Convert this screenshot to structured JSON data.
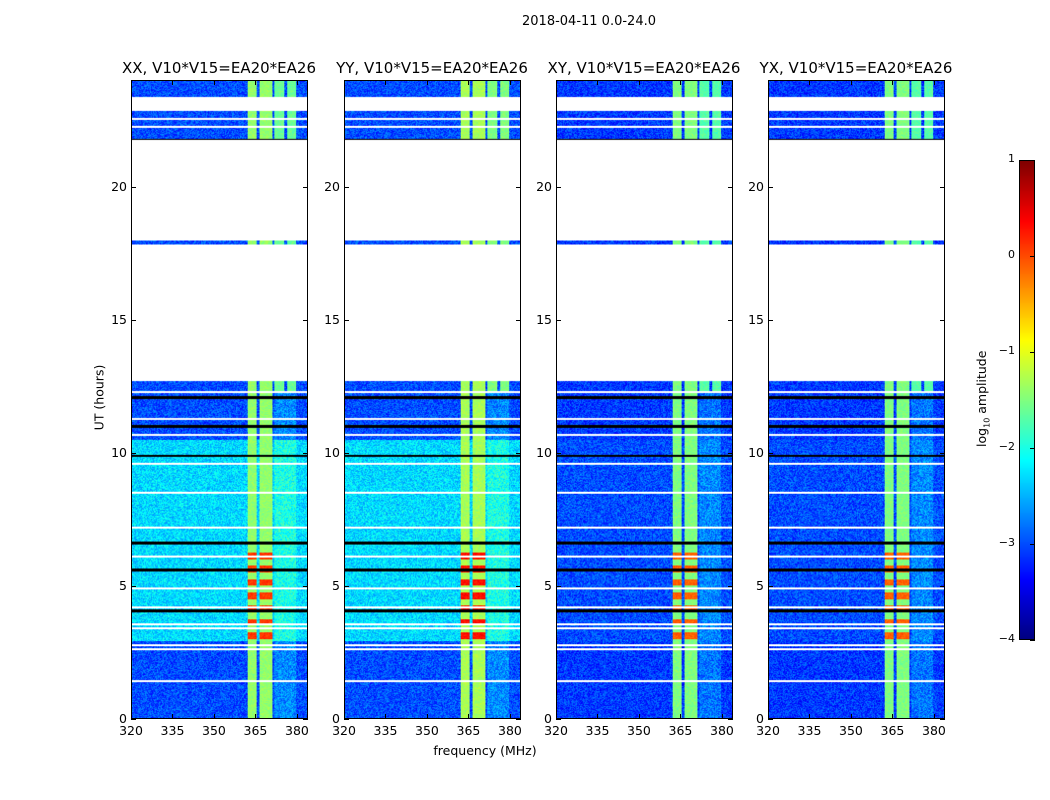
{
  "chart_data": {
    "type": "heatmap",
    "title": "2018-04-11 0.0-24.0",
    "xlabel": "frequency (MHz)",
    "ylabel": "UT (hours)",
    "xlim": [
      320,
      384
    ],
    "ylim": [
      0,
      24
    ],
    "xticks": [
      320,
      335,
      350,
      365,
      380
    ],
    "yticks": [
      0,
      5,
      10,
      15,
      20
    ],
    "colorbar": {
      "label": "log10 amplitude",
      "label_main": "log",
      "label_sub": "10",
      "label_tail": " amplitude",
      "range": [
        -4,
        1
      ],
      "ticks": [
        1,
        0,
        -1,
        -2,
        -3,
        -4
      ],
      "tick_labels": [
        "1",
        "0",
        "−1",
        "−2",
        "−3",
        "−4"
      ],
      "colormap": "jet"
    },
    "panels": [
      {
        "title": "XX, V10*V15=EA20*EA26",
        "base_low": -3.0,
        "base_mid": -2.3,
        "band_level": -1.4,
        "hot_level": 0.1
      },
      {
        "title": "YY, V10*V15=EA20*EA26",
        "base_low": -3.0,
        "base_mid": -2.3,
        "band_level": -1.3,
        "hot_level": 0.3
      },
      {
        "title": "XY, V10*V15=EA20*EA26",
        "base_low": -3.1,
        "base_mid": -3.0,
        "band_level": -1.5,
        "hot_level": -0.1
      },
      {
        "title": "YX, V10*V15=EA20*EA26",
        "base_low": -3.1,
        "base_mid": -3.0,
        "band_level": -1.5,
        "hot_level": -0.1
      }
    ],
    "data_segments_hours": [
      [
        0,
        12.7
      ],
      [
        17.85,
        18.0
      ],
      [
        21.8,
        22.9
      ],
      [
        23.4,
        24
      ]
    ],
    "flagged_lines_hours": [
      1.4,
      2.6,
      2.75,
      3.4,
      3.55,
      4.2,
      4.9,
      6.1,
      7.2,
      8.5,
      9.6,
      10.7,
      11.3,
      12.3,
      22.3,
      22.6
    ],
    "dark_lines_hours": [
      5.6,
      4.05,
      6.6,
      9.9,
      11.0,
      12.1,
      21.8
    ],
    "rfi_band_mhz": [
      362,
      371
    ],
    "hot_time_hours": [
      3.0,
      6.5
    ],
    "upper_band_mhz": [
      372,
      380
    ]
  }
}
